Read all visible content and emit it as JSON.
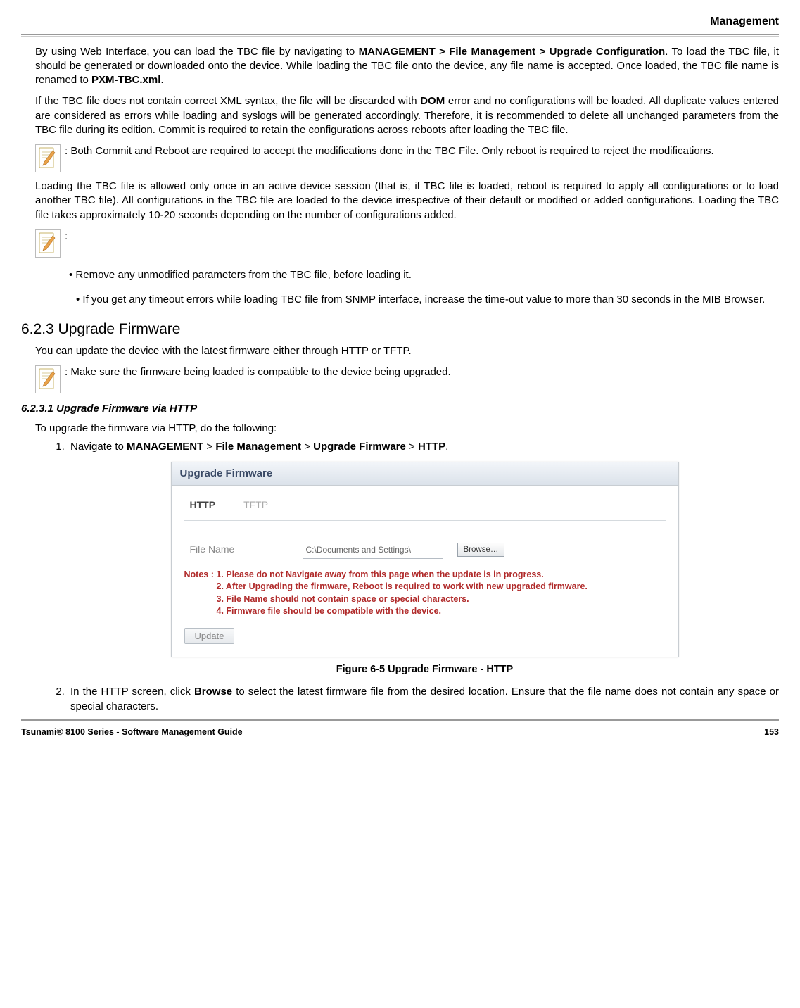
{
  "header": {
    "section": "Management"
  },
  "p1": {
    "t1": "By using Web Interface, you can load the TBC file by navigating to ",
    "b1": "MANAGEMENT > File Management > Upgrade Configuration",
    "t2": ". To load the TBC file, it should be generated or downloaded onto the device. While loading the TBC file onto the device, any file name is accepted. Once loaded, the TBC file name is renamed to ",
    "b2": "PXM-TBC.xml",
    "t3": "."
  },
  "p2": {
    "t1": "If the TBC file does not contain correct XML syntax, the file will be discarded with ",
    "b1": "DOM",
    "t2": " error and no configurations will be loaded. All duplicate values entered are considered as errors while loading and syslogs will be generated accordingly. Therefore, it is recommended to delete all unchanged parameters from the TBC file during its edition. Commit is required to retain the configurations across reboots after loading the TBC file."
  },
  "note1": ": Both Commit and Reboot are required to accept the modifications done in the TBC File. Only reboot is required to reject the modifications.",
  "p3": "Loading the TBC file is allowed only once in an active device session (that is, if TBC file is loaded, reboot is required to apply all configurations or to load another TBC file). All configurations in the TBC file are loaded to the device irrespective of their default or modified or added configurations. Loading the TBC file takes approximately 10-20 seconds depending on the number of configurations added.",
  "note2_prefix": ":",
  "bullet1": "• Remove any unmodified parameters from the TBC file, before loading it.",
  "bullet2": "• If you get any timeout errors while loading TBC file from SNMP interface, increase the time-out value to more than 30 seconds in the MIB Browser.",
  "sec623_title": "6.2.3 Upgrade Firmware",
  "sec623_intro": "You can update the device with the latest firmware either through HTTP or TFTP.",
  "note3": ": Make sure the firmware being loaded is compatible to the device being upgraded.",
  "sec6231_title": "6.2.3.1 Upgrade Firmware via HTTP",
  "sec6231_intro": "To upgrade the firmware via HTTP, do the following:",
  "step1": {
    "t1": "Navigate to ",
    "b1": "MANAGEMENT",
    "s1": " > ",
    "b2": "File Management",
    "s2": " > ",
    "b3": "Upgrade Firmware",
    "s3": " > ",
    "b4": "HTTP",
    "t2": "."
  },
  "panel": {
    "title": "Upgrade Firmware",
    "tab_http": "HTTP",
    "tab_tftp": "TFTP",
    "file_label": "File Name",
    "file_value": "C:\\Documents and Settings\\",
    "browse": "Browse…",
    "notes_l1": "Notes :  1. Please do not Navigate away from this page when the update is in progress.",
    "notes_l2": "2. After Upgrading the firmware, Reboot is required to work with new upgraded firmware.",
    "notes_l3": "3. File Name should not contain space or special characters.",
    "notes_l4": "4. Firmware file should be compatible with the device.",
    "update": "Update"
  },
  "figure_caption": "Figure 6-5 Upgrade Firmware - HTTP",
  "step2": {
    "t1": "In the HTTP screen, click ",
    "b1": "Browse",
    "t2": " to select the latest firmware file from the desired location. Ensure that the file name does not contain any space or special characters."
  },
  "footer": {
    "left": "Tsunami® 8100 Series - Software Management Guide",
    "right": "153"
  }
}
